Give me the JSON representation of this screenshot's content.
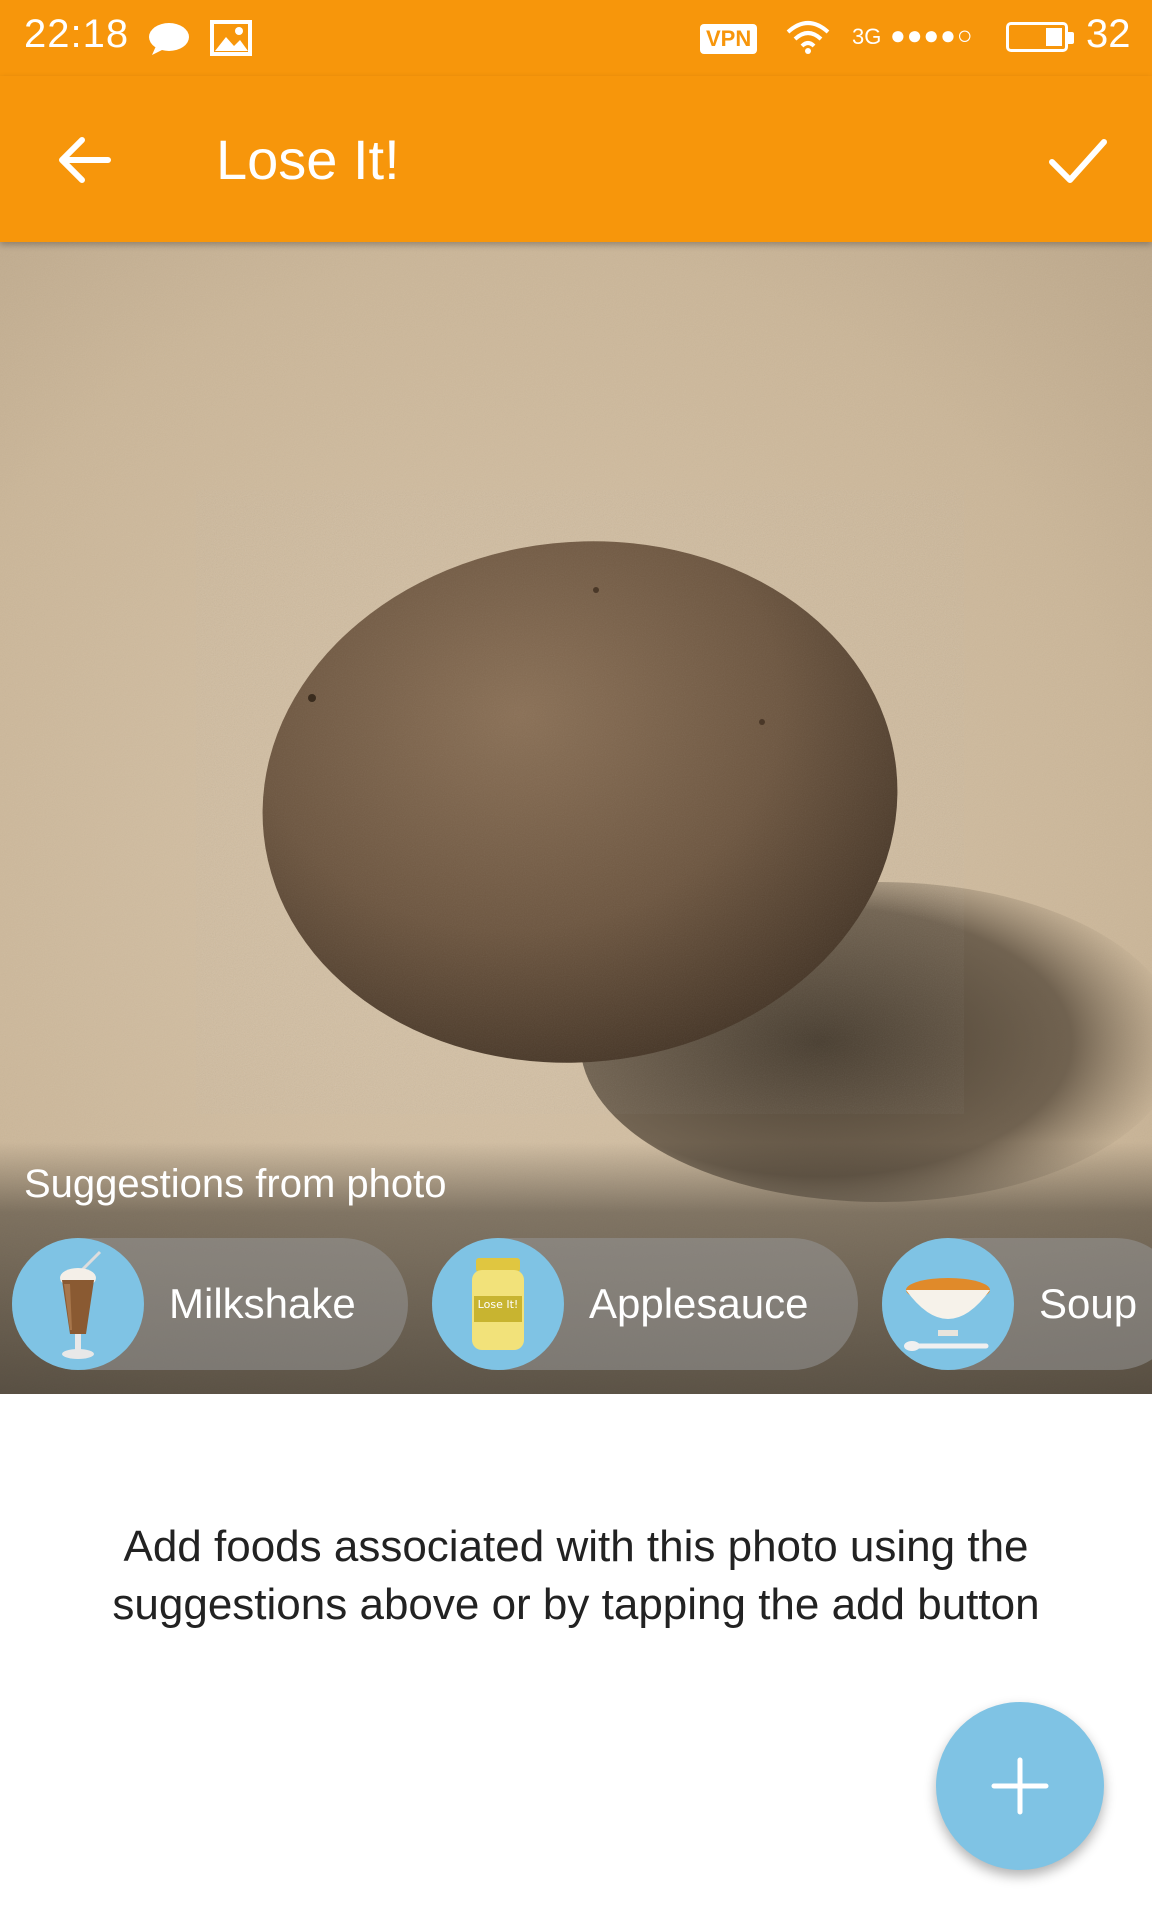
{
  "status_bar": {
    "time": "22:18",
    "vpn_label": "VPN",
    "network": "3G",
    "signal_dots": "●●●●○",
    "battery_level": "32",
    "icons": [
      "chat-icon",
      "image-icon",
      "wifi-icon",
      "battery-icon"
    ]
  },
  "app_bar": {
    "title": "Lose It!",
    "back_icon": "arrow-left-icon",
    "confirm_icon": "checkmark-icon"
  },
  "photo": {
    "suggestions_title": "Suggestions from photo",
    "suggestions": [
      {
        "label": "Milkshake",
        "icon": "milkshake-icon"
      },
      {
        "label": "Applesauce",
        "icon": "applesauce-jar-icon",
        "jar_text": "Lose It!"
      },
      {
        "label": "Soup",
        "icon": "soup-bowl-icon"
      }
    ]
  },
  "content": {
    "message": "Add foods associated with this photo using the suggestions above or by tapping the add button"
  },
  "fab": {
    "icon": "plus-icon"
  },
  "colors": {
    "accent": "#f7960b",
    "fab": "#7fc3e4",
    "chip_icon_bg": "#7fc3e4"
  }
}
